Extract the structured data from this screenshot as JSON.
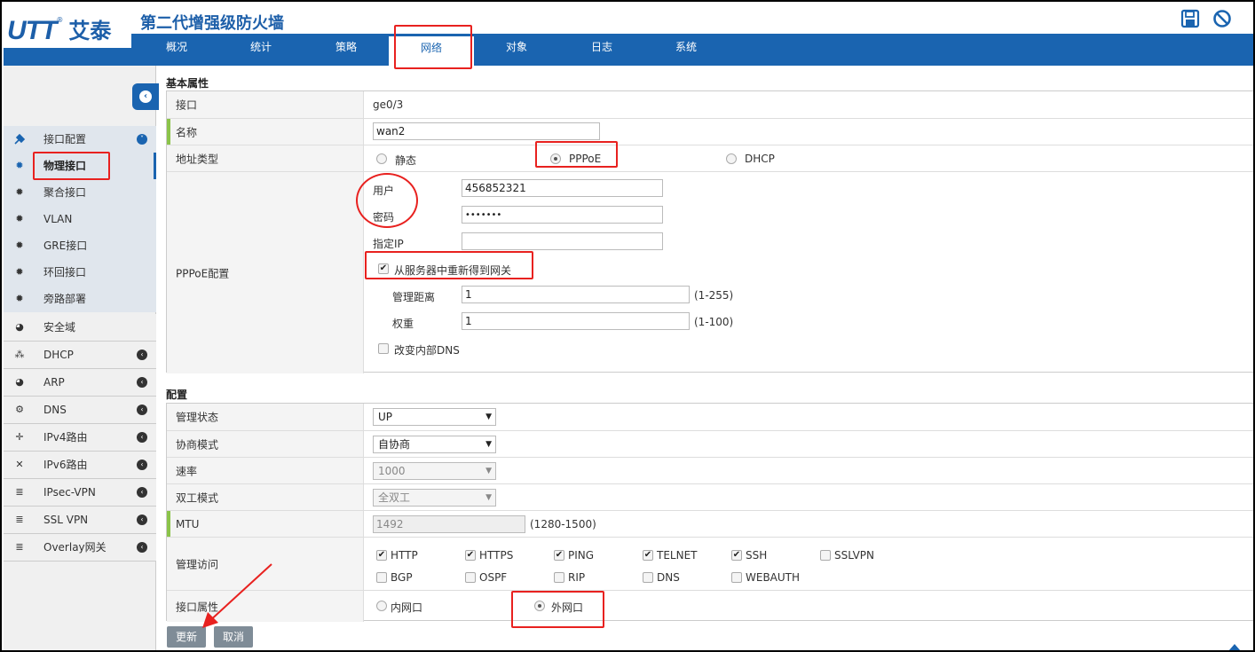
{
  "header": {
    "logo_text": "UTT",
    "logo_cn": "艾泰",
    "logo_reg": "®",
    "title": "第二代增强级防火墙"
  },
  "nav": {
    "tabs": [
      {
        "label": "概况"
      },
      {
        "label": "统计"
      },
      {
        "label": "策略"
      },
      {
        "label": "网络",
        "active": true
      },
      {
        "label": "对象"
      },
      {
        "label": "日志"
      },
      {
        "label": "系统"
      }
    ]
  },
  "sidebar": {
    "group_label": "接口配置",
    "sub_items": [
      {
        "label": "物理接口",
        "icon": "gear-icon",
        "active": true
      },
      {
        "label": "聚合接口",
        "icon": "gear-icon"
      },
      {
        "label": "VLAN",
        "icon": "gear-icon"
      },
      {
        "label": "GRE接口",
        "icon": "gear-icon"
      },
      {
        "label": "环回接口",
        "icon": "gear-icon"
      },
      {
        "label": "旁路部署",
        "icon": "gear-icon"
      }
    ],
    "items": [
      {
        "label": "安全域",
        "icon": "globe-icon"
      },
      {
        "label": "DHCP",
        "icon": "sitemap-icon"
      },
      {
        "label": "ARP",
        "icon": "globe-icon"
      },
      {
        "label": "DNS",
        "icon": "cogs-icon"
      },
      {
        "label": "IPv4路由",
        "icon": "move-icon"
      },
      {
        "label": "IPv6路由",
        "icon": "cross-arrows-icon"
      },
      {
        "label": "IPsec-VPN",
        "icon": "list-icon"
      },
      {
        "label": "SSL VPN",
        "icon": "list-icon"
      },
      {
        "label": "Overlay网关",
        "icon": "list-icon"
      }
    ]
  },
  "basic": {
    "section_title": "基本属性",
    "interface_label": "接口",
    "interface_value": "ge0/3",
    "name_label": "名称",
    "name_value": "wan2",
    "addr_type_label": "地址类型",
    "addr_options": [
      "静态",
      "PPPoE",
      "DHCP"
    ],
    "addr_selected": "PPPoE",
    "pppoe_label": "PPPoE配置",
    "user_label": "用户",
    "user_value": "456852321",
    "password_label": "密码",
    "password_value": "•••••••",
    "static_ip_label": "指定IP",
    "static_ip_value": "",
    "gateway_label": "从服务器中重新得到网关",
    "gateway_checked": true,
    "distance_label": "管理距离",
    "distance_value": "1",
    "distance_range": "(1-255)",
    "weight_label": "权重",
    "weight_value": "1",
    "weight_range": "(1-100)",
    "dns_label": "改变内部DNS",
    "dns_checked": false
  },
  "config": {
    "section_title": "配置",
    "admin_state_label": "管理状态",
    "admin_state_value": "UP",
    "negotiate_label": "协商模式",
    "negotiate_value": "自协商",
    "speed_label": "速率",
    "speed_value": "1000",
    "duplex_label": "双工模式",
    "duplex_value": "全双工",
    "mtu_label": "MTU",
    "mtu_value": "1492",
    "mtu_range": "(1280-1500)",
    "access_label": "管理访问",
    "access_row1": [
      {
        "label": "HTTP",
        "checked": true
      },
      {
        "label": "HTTPS",
        "checked": true
      },
      {
        "label": "PING",
        "checked": true
      },
      {
        "label": "TELNET",
        "checked": true
      },
      {
        "label": "SSH",
        "checked": true
      },
      {
        "label": "SSLVPN",
        "checked": false
      }
    ],
    "access_row2": [
      {
        "label": "BGP",
        "checked": false
      },
      {
        "label": "OSPF",
        "checked": false
      },
      {
        "label": "RIP",
        "checked": false
      },
      {
        "label": "DNS",
        "checked": false
      },
      {
        "label": "WEBAUTH",
        "checked": false
      }
    ],
    "iface_prop_label": "接口属性",
    "iface_options": [
      "内网口",
      "外网口"
    ],
    "iface_selected": "外网口"
  },
  "buttons": {
    "update": "更新",
    "cancel": "取消"
  },
  "colors": {
    "brand": "#1a64b0",
    "annotation": "#e8211f"
  }
}
